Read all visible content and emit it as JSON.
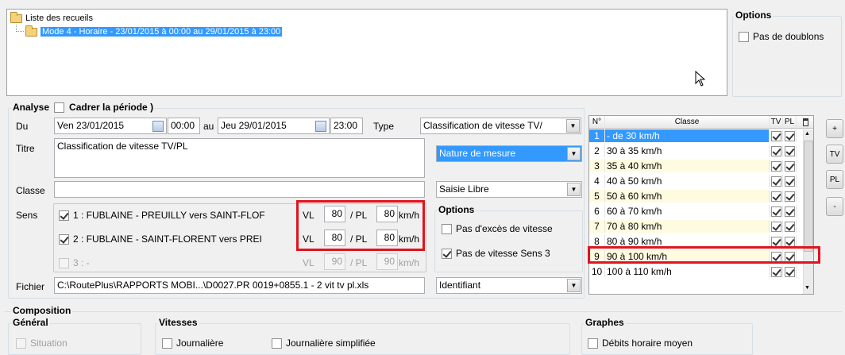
{
  "tree": {
    "root_label": "Liste des recueils",
    "child_label": "Mode 4 - Horaire - 23/01/2015 à 00:00 au 29/01/2015 à 23:00"
  },
  "options_top": {
    "title": "Options",
    "no_duplicates_label": "Pas de doublons",
    "no_duplicates_checked": false
  },
  "analyse": {
    "title": "Analyse",
    "cadrer_label": "Cadrer la période )",
    "cadrer_checked": false,
    "du_label": "Du",
    "date_from": "Ven 23/01/2015",
    "time_from": "00:00",
    "au_label": "au",
    "date_to": "Jeu 29/01/2015",
    "time_to": "23:00",
    "type_label": "Type",
    "type_value": "Classification de vitesse TV/",
    "titre_label": "Titre",
    "titre_value": "Classification de vitesse TV/PL",
    "nature_value": "Nature de mesure",
    "classe_label": "Classe",
    "classe_value": "",
    "saisie_value": "Saisie Libre",
    "sens_label": "Sens",
    "sens": [
      {
        "label": "1 : FUBLAINE - PREUILLY vers SAINT-FLOF",
        "checked": true,
        "vl": "80",
        "pl": "80",
        "enabled": true
      },
      {
        "label": "2 : FUBLAINE - SAINT-FLORENT vers PREI",
        "checked": true,
        "vl": "80",
        "pl": "80",
        "enabled": true
      },
      {
        "label": "3 : -",
        "checked": false,
        "vl": "90",
        "pl": "90",
        "enabled": false
      }
    ],
    "vl_label": "VL",
    "pl_label": "/ PL",
    "unit_label": "km/h",
    "fichier_label": "Fichier",
    "fichier_value": "C:\\RoutePlus\\RAPPORTS MOBI...\\D0027.PR 0019+0855.1 - 2 vit tv pl.xls",
    "identifiant_value": "Identifiant"
  },
  "options_mid": {
    "title": "Options",
    "no_speeding_label": "Pas d'excès de vitesse",
    "no_speeding_checked": false,
    "no_speed_sens3_label": "Pas de vitesse Sens 3",
    "no_speed_sens3_checked": true
  },
  "grid": {
    "headers": {
      "num": "N°",
      "classe": "Classe",
      "tv": "TV",
      "pl": "PL"
    },
    "rows": [
      {
        "n": "1",
        "classe": "- de 30 km/h",
        "tv": true,
        "pl": true,
        "selected": true
      },
      {
        "n": "2",
        "classe": "30 à 35 km/h",
        "tv": true,
        "pl": true
      },
      {
        "n": "3",
        "classe": "35 à 40 km/h",
        "tv": true,
        "pl": true
      },
      {
        "n": "4",
        "classe": "40 à 50 km/h",
        "tv": true,
        "pl": true
      },
      {
        "n": "5",
        "classe": "50 à 60 km/h",
        "tv": true,
        "pl": true
      },
      {
        "n": "6",
        "classe": "60 à 70 km/h",
        "tv": true,
        "pl": true
      },
      {
        "n": "7",
        "classe": "70 à 80 km/h",
        "tv": true,
        "pl": true
      },
      {
        "n": "8",
        "classe": "80 à 90 km/h",
        "tv": true,
        "pl": true
      },
      {
        "n": "9",
        "classe": "90 à 100 km/h",
        "tv": true,
        "pl": true
      },
      {
        "n": "10",
        "classe": "100 à 110 km/h",
        "tv": true,
        "pl": true
      }
    ]
  },
  "side_buttons": [
    "+",
    "TV",
    "PL",
    "-"
  ],
  "composition": {
    "title": "Composition",
    "general_title": "Général",
    "situation_label": "Situation",
    "vitesses_title": "Vitesses",
    "journaliere_label": "Journalière",
    "journaliere_simplifiee_label": "Journalière simplifiée",
    "graphes_title": "Graphes",
    "debits_label": "Débits horaire moyen"
  },
  "colors": {
    "selection": "#3399ff",
    "highlight_border": "#e0141e",
    "row_alt": "#fffbe0"
  }
}
